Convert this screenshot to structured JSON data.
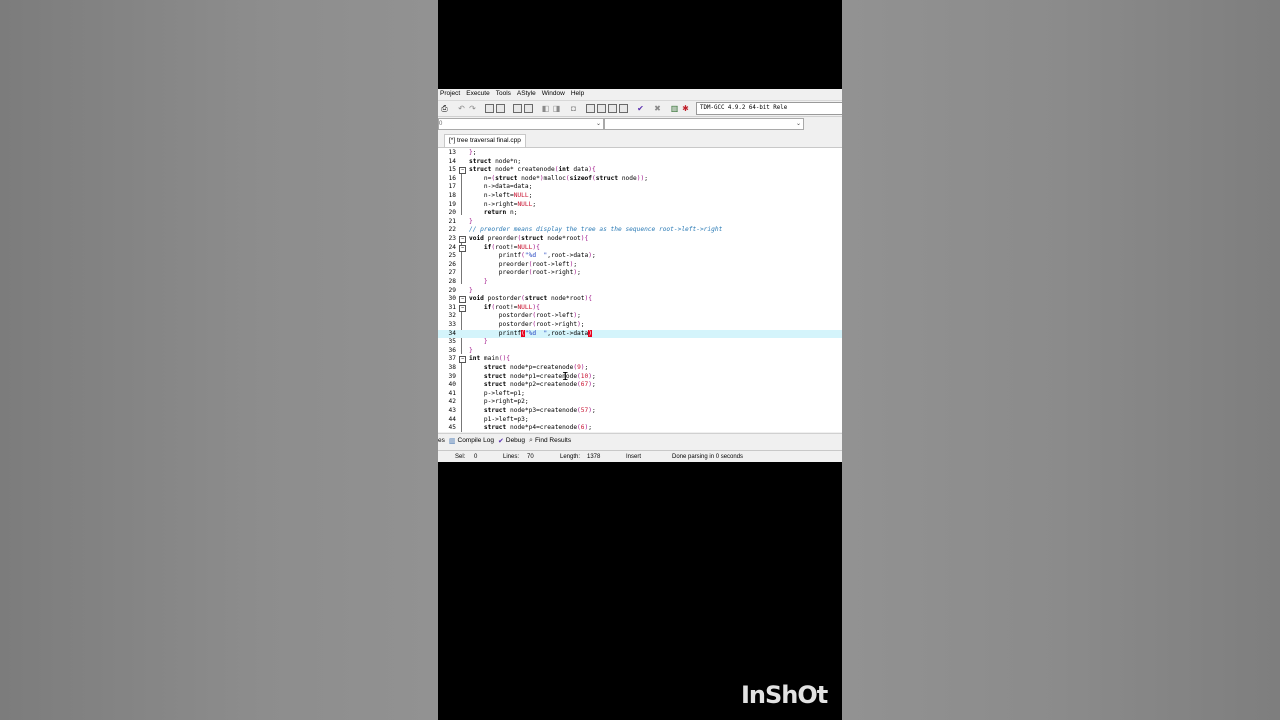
{
  "menu": [
    "Project",
    "Execute",
    "Tools",
    "AStyle",
    "Window",
    "Help"
  ],
  "toolbar": {
    "icons": [
      "print-icon",
      "undo-icon",
      "redo-icon",
      "find-icon",
      "replace-icon",
      "indent-icon",
      "unindent-icon",
      "bookmark-prev-icon",
      "bookmark-next-icon",
      "goto-icon",
      "new-class-icon",
      "grid-icon",
      "window-icon",
      "layout-icon",
      "check-icon",
      "stop-icon",
      "chart-icon",
      "debug-icon"
    ],
    "compiler": "TDM-GCC 4.9.2 64-bit Rele"
  },
  "combos": {
    "left_value": "0",
    "right_value": ""
  },
  "file_tab": "[*] tree traversal final.cpp",
  "code_lines": [
    {
      "n": "13",
      "t": "};"
    },
    {
      "n": "14",
      "t": "struct node*n;"
    },
    {
      "n": "15",
      "t": "struct node* createnode(int data){"
    },
    {
      "n": "16",
      "t": "    n=(struct node*)malloc(sizeof(struct node));"
    },
    {
      "n": "17",
      "t": "    n->data=data;"
    },
    {
      "n": "18",
      "t": "    n->left=NULL;"
    },
    {
      "n": "19",
      "t": "    n->right=NULL;"
    },
    {
      "n": "20",
      "t": "    return n;"
    },
    {
      "n": "21",
      "t": "}"
    },
    {
      "n": "22",
      "t": "// preorder means display the tree as the sequence root->left->right"
    },
    {
      "n": "23",
      "t": "void preorder(struct node*root){"
    },
    {
      "n": "24",
      "t": "    if(root!=NULL){"
    },
    {
      "n": "25",
      "t": "        printf(\"%d  \",root->data);"
    },
    {
      "n": "26",
      "t": "        preorder(root->left);"
    },
    {
      "n": "27",
      "t": "        preorder(root->right);"
    },
    {
      "n": "28",
      "t": "    }"
    },
    {
      "n": "29",
      "t": "}"
    },
    {
      "n": "30",
      "t": "void postorder(struct node*root){"
    },
    {
      "n": "31",
      "t": "    if(root!=NULL){"
    },
    {
      "n": "32",
      "t": "        postorder(root->left);"
    },
    {
      "n": "33",
      "t": "        postorder(root->right);"
    },
    {
      "n": "34",
      "t": "        printf(\"%d  \",root->data)"
    },
    {
      "n": "35",
      "t": "    }"
    },
    {
      "n": "36",
      "t": "}"
    },
    {
      "n": "37",
      "t": "int main(){"
    },
    {
      "n": "38",
      "t": "    struct node*p=createnode(9);"
    },
    {
      "n": "39",
      "t": "    struct node*p1=createnode(10);"
    },
    {
      "n": "40",
      "t": "    struct node*p2=createnode(67);"
    },
    {
      "n": "41",
      "t": "    p->left=p1;"
    },
    {
      "n": "42",
      "t": "    p->right=p2;"
    },
    {
      "n": "43",
      "t": "    struct node*p3=createnode(57);"
    },
    {
      "n": "44",
      "t": "    p1->left=p3;"
    },
    {
      "n": "45",
      "t": "    struct node*p4=createnode(6);"
    }
  ],
  "bottom_tabs": [
    "es",
    "Compile Log",
    "Debug",
    "Find Results"
  ],
  "status": {
    "sel_label": "Sel:",
    "sel_value": "0",
    "lines_label": "Lines:",
    "lines_value": "70",
    "length_label": "Length:",
    "length_value": "1378",
    "mode": "Insert",
    "message": "Done parsing in 0 seconds"
  },
  "watermark": "InShOt"
}
